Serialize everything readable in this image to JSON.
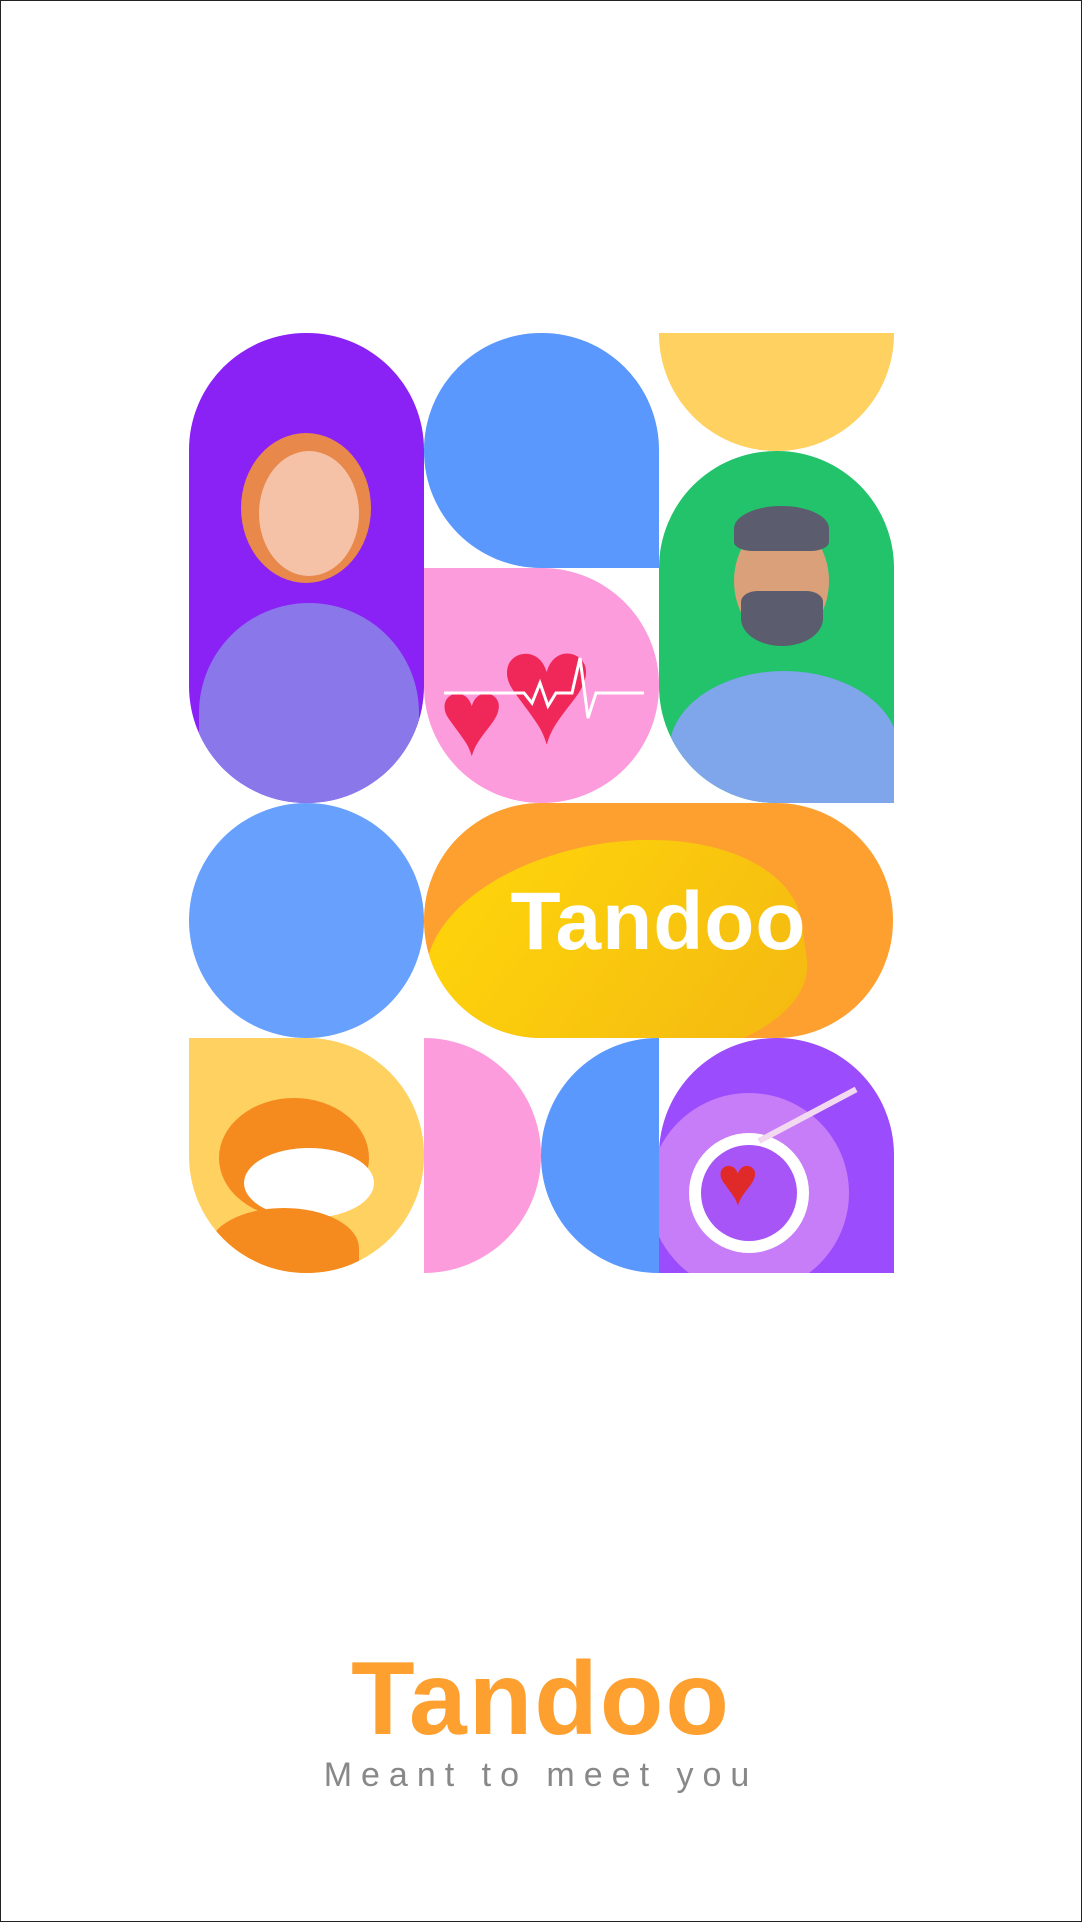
{
  "splash": {
    "logo_text": "Tandoo",
    "brand_name": "Tandoo",
    "tagline": "Meant to meet you"
  },
  "colors": {
    "brand_orange": "#fda030",
    "purple": "#8b22f5",
    "blue": "#5a98fd",
    "yellow": "#fed160",
    "green": "#22c36b",
    "pink": "#fd9cdc",
    "tagline_gray": "#888888"
  }
}
